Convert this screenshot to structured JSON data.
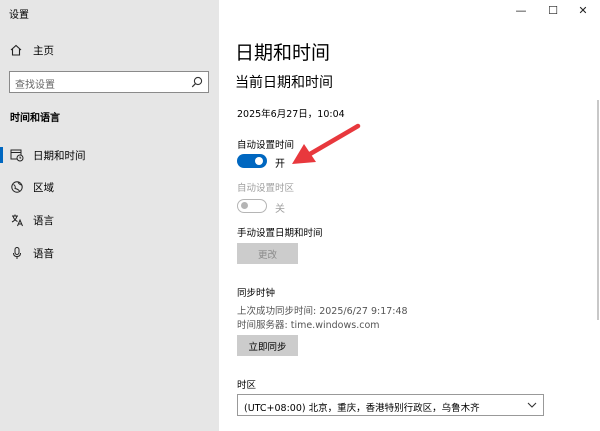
{
  "window": {
    "title": "设置",
    "minimize_glyph": "—",
    "maximize_glyph": "☐",
    "close_glyph": "✕"
  },
  "sidebar": {
    "home_label": "主页",
    "search_placeholder": "查找设置",
    "section_title": "时间和语言",
    "items": [
      {
        "label": "日期和时间",
        "icon": "calendar-clock-icon",
        "active": true
      },
      {
        "label": "区域",
        "icon": "globe-icon",
        "active": false
      },
      {
        "label": "语言",
        "icon": "language-icon",
        "active": false
      },
      {
        "label": "语音",
        "icon": "microphone-icon",
        "active": false
      }
    ]
  },
  "main": {
    "page_title": "日期和时间",
    "section_title": "当前日期和时间",
    "current_datetime": "2025年6月27日，10:04",
    "auto_time": {
      "label": "自动设置时间",
      "state": "开",
      "on": true
    },
    "auto_timezone": {
      "label": "自动设置时区",
      "state": "关",
      "on": false
    },
    "manual": {
      "label": "手动设置日期和时间",
      "button": "更改"
    },
    "sync": {
      "title": "同步时钟",
      "last_sync": "上次成功同步时间: 2025/6/27 9:17:48",
      "server": "时间服务器: time.windows.com",
      "button": "立即同步"
    },
    "timezone": {
      "label": "时区",
      "value": "(UTC+08:00) 北京，重庆，香港特别行政区，乌鲁木齐"
    }
  },
  "colors": {
    "accent": "#0067c0",
    "sidebar_bg": "#e6e6e6",
    "annotation_arrow": "#e8383d"
  }
}
